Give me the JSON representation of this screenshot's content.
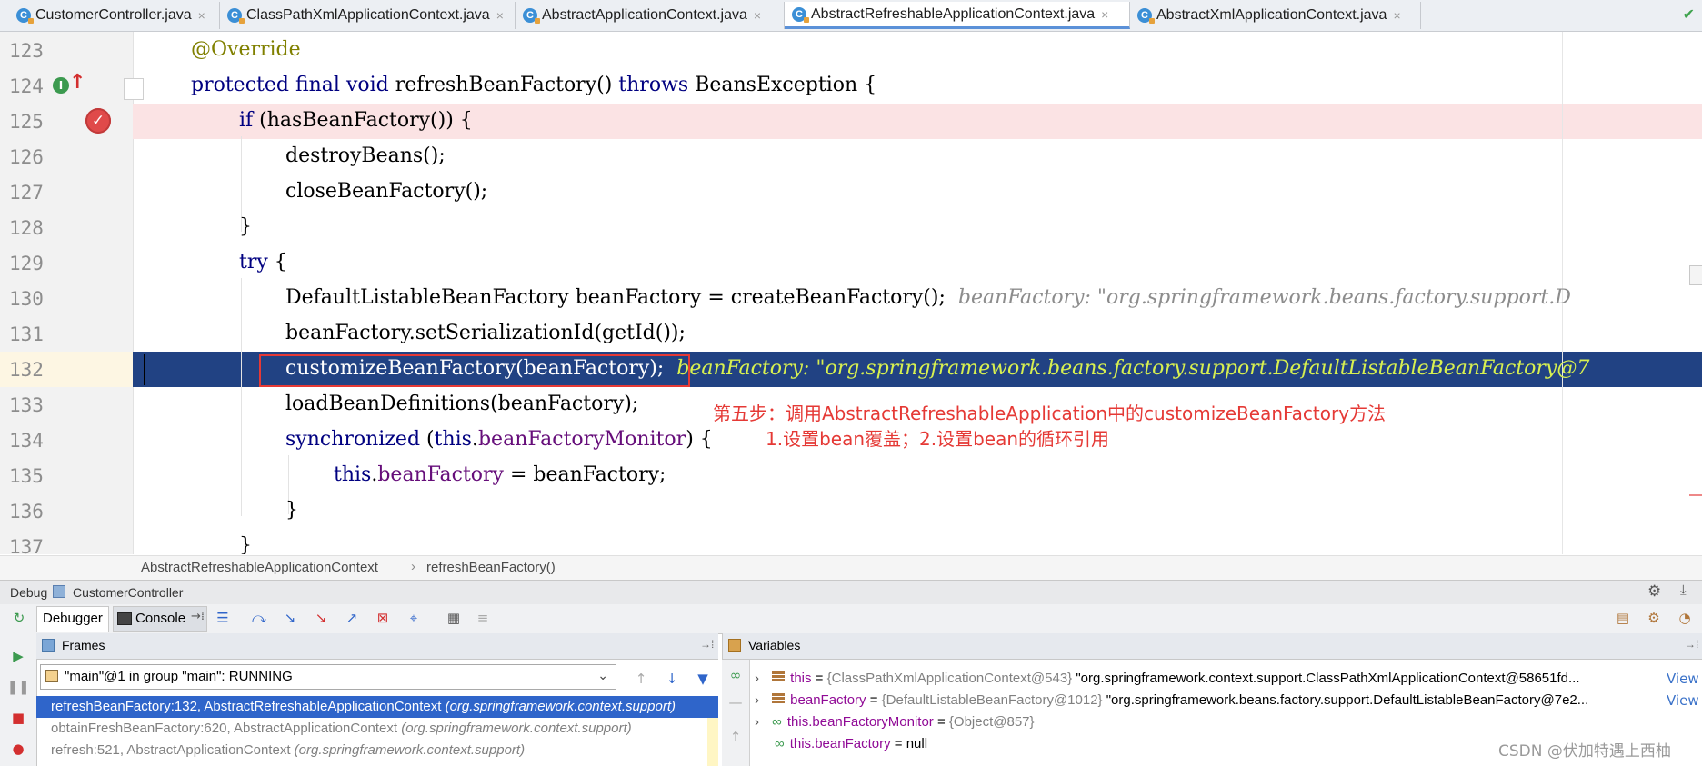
{
  "tabs": [
    {
      "label": "CustomerController.java",
      "icon": "C",
      "active": false
    },
    {
      "label": "ClassPathXmlApplicationContext.java",
      "icon": "C",
      "active": false
    },
    {
      "label": "AbstractApplicationContext.java",
      "icon": "C",
      "active": false
    },
    {
      "label": "AbstractRefreshableApplicationContext.java",
      "icon": "C",
      "active": true
    },
    {
      "label": "AbstractXmlApplicationContext.java",
      "icon": "C",
      "active": false
    }
  ],
  "tab_close": "×",
  "line_numbers": [
    "123",
    "124",
    "125",
    "126",
    "127",
    "128",
    "129",
    "130",
    "131",
    "132",
    "133",
    "134",
    "135",
    "136",
    "137"
  ],
  "code": {
    "l123": "@Override",
    "l124_kw": "protected final void",
    "l124_rest": " refreshBeanFactory() ",
    "l124_kw2": "throws",
    "l124_end": " BeansException {",
    "l125_kw": "if",
    "l125_rest": " (hasBeanFactory()) {",
    "l126": "destroyBeans();",
    "l127": "closeBeanFactory();",
    "l128": "}",
    "l129_kw": "try",
    "l129_rest": " {",
    "l130": "DefaultListableBeanFactory beanFactory = createBeanFactory();",
    "l130_hint": "beanFactory: \"org.springframework.beans.factory.support.D",
    "l131": "beanFactory.setSerializationId(getId());",
    "l132": "customizeBeanFactory(beanFactory);",
    "l132_hint": "beanFactory: \"org.springframework.beans.factory.support.DefaultListableBeanFactory@7",
    "l133": "loadBeanDefinitions(beanFactory);",
    "l134_kw": "synchronized",
    "l134_mid": " (",
    "l134_this": "this",
    "l134_dot": ".",
    "l134_fld": "beanFactoryMonitor",
    "l134_end": ") {",
    "l135_this": "this",
    "l135_dot": ".",
    "l135_fld": "beanFactory",
    "l135_end": " = beanFactory;",
    "l136": "}",
    "l137": "}"
  },
  "annotations": {
    "step": "第五步：调用AbstractRefreshableApplication中的customizeBeanFactory方法",
    "detail": "1.设置bean覆盖；2.设置bean的循环引用"
  },
  "breadcrumb": [
    "AbstractRefreshableApplicationContext",
    "refreshBeanFactory()"
  ],
  "breadcrumb_sep": "›",
  "debug": {
    "label": "Debug",
    "config": "CustomerController",
    "tabs": [
      "Debugger",
      "Console"
    ],
    "frames_title": "Frames",
    "variables_title": "Variables",
    "thread": "\"main\"@1 in group \"main\": RUNNING",
    "frames": [
      {
        "method": "refreshBeanFactory:132, AbstractRefreshableApplicationContext ",
        "pkg": "(org.springframework.context.support)"
      },
      {
        "method": "obtainFreshBeanFactory:620, AbstractApplicationContext ",
        "pkg": "(org.springframework.context.support)"
      },
      {
        "method": "refresh:521, AbstractApplicationContext ",
        "pkg": "(org.springframework.context.support)"
      }
    ],
    "variables": [
      {
        "name": "this",
        "eq": " = ",
        "type": "{ClassPathXmlApplicationContext@543}",
        "value": " \"org.springframework.context.support.ClassPathXmlApplicationContext@58651fd...",
        "link": "View"
      },
      {
        "name": "beanFactory",
        "eq": " = ",
        "type": "{DefaultListableBeanFactory@1012}",
        "value": " \"org.springframework.beans.factory.support.DefaultListableBeanFactory@7e2...",
        "link": "View"
      },
      {
        "name": "this.beanFactoryMonitor",
        "eq": " = ",
        "type": "{Object@857}",
        "value": "",
        "link": ""
      },
      {
        "name": "this.beanFactory",
        "eq": " = ",
        "type": "",
        "value": "null",
        "link": ""
      }
    ]
  },
  "watermark": "CSDN @伏加特遇上西柚",
  "colors": {
    "keyword": "#000080",
    "annotation": "#808000",
    "field": "#660e7a",
    "selection": "#214283",
    "error_line": "#fbe3e4",
    "frame_selected": "#2f65ca",
    "annotation_red": "#e53935"
  }
}
